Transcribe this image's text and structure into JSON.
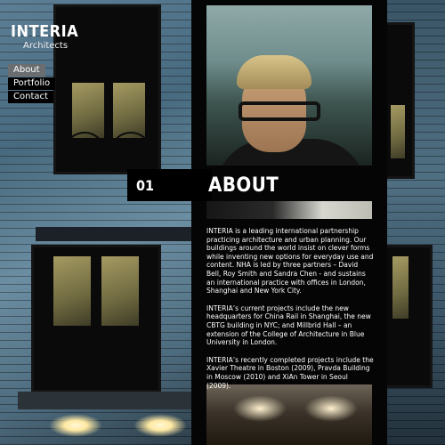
{
  "brand": {
    "name": "INTERIA",
    "tagline": "Architects"
  },
  "nav": {
    "items": [
      {
        "label": "About",
        "active": true
      },
      {
        "label": "Portfolio",
        "active": false
      },
      {
        "label": "Contact",
        "active": false
      }
    ]
  },
  "section": {
    "number": "01",
    "title": "ABOUT"
  },
  "content": {
    "paragraphs": [
      "INTERIA is a leading international partnership practicing architecture and urban planning. Our buildings around the world insist on clever forms while inventing new options for everyday use and content. NHA is led by three partners – David Bell, Roy Smith and Sandra Chen - and sustains an international practice with offices in London, Shanghai and New York City.",
      "INTERIA’s current projects include the new headquarters for China Rail in Shanghai, the new CBTG building in NYC; and Millbrid Hall – an extension of the College of Architecture in Blue University in London.",
      "INTERIA’s recently completed projects include the Xavier Theatre in Boston (2009), Pravda Building in Moscow (2010) and XiAn Tower in Seoul (2009)."
    ]
  },
  "colors": {
    "nav_active_bg": "#6b6e70",
    "nav_bg": "#000000",
    "text": "#ffffff"
  }
}
